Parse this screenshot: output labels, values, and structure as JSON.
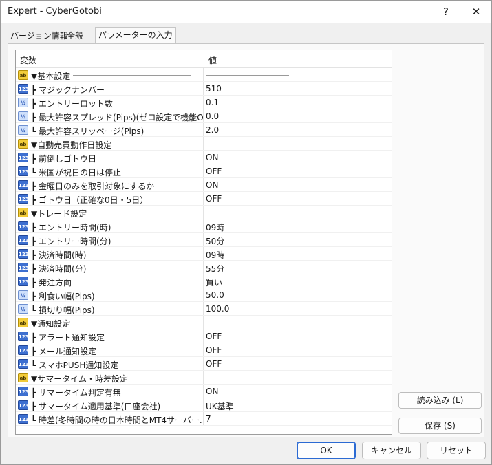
{
  "window": {
    "title": "Expert - CyberGotobi",
    "help": "?",
    "close": "✕"
  },
  "tabs": [
    {
      "label": "バージョン情報"
    },
    {
      "label": "全般"
    },
    {
      "label": "パラメーターの入力"
    }
  ],
  "grid": {
    "col_variable": "変数",
    "col_value": "値",
    "rows": [
      {
        "type": "str",
        "icon": "ab",
        "label": "▼基本設定",
        "value": "",
        "group": true
      },
      {
        "type": "int",
        "icon": "123",
        "label": "┣ マジックナンバー",
        "value": "510"
      },
      {
        "type": "dbl",
        "icon": "½",
        "label": "┣ エントリーロット数",
        "value": "0.1"
      },
      {
        "type": "dbl",
        "icon": "½",
        "label": "┣ 最大許容スプレッド(Pips)(ゼロ設定で機能Off)",
        "value": "0.0"
      },
      {
        "type": "dbl",
        "icon": "½",
        "label": "┗ 最大許容スリッページ(Pips)",
        "value": "2.0"
      },
      {
        "type": "str",
        "icon": "ab",
        "label": "▼自動売買動作日設定",
        "value": "",
        "group": true
      },
      {
        "type": "int",
        "icon": "123",
        "label": "┣ 前倒しゴトウ日",
        "value": "ON"
      },
      {
        "type": "int",
        "icon": "123",
        "label": "┗ 米国が祝日の日は停止",
        "value": "OFF"
      },
      {
        "type": "int",
        "icon": "123",
        "label": "┣ 金曜日のみを取引対象にするか",
        "value": "ON"
      },
      {
        "type": "int",
        "icon": "123",
        "label": "┣ ゴトウ日（正確な0日・5日）",
        "value": "OFF"
      },
      {
        "type": "str",
        "icon": "ab",
        "label": "▼トレード設定",
        "value": "",
        "group": true
      },
      {
        "type": "int",
        "icon": "123",
        "label": "┣ エントリー時間(時)",
        "value": "09時"
      },
      {
        "type": "int",
        "icon": "123",
        "label": "┣ エントリー時間(分)",
        "value": "50分"
      },
      {
        "type": "int",
        "icon": "123",
        "label": "┣ 決済時間(時)",
        "value": "09時"
      },
      {
        "type": "int",
        "icon": "123",
        "label": "┣ 決済時間(分)",
        "value": "55分"
      },
      {
        "type": "int",
        "icon": "123",
        "label": "┣ 発注方向",
        "value": "買い"
      },
      {
        "type": "dbl",
        "icon": "½",
        "label": "┣ 利食い幅(Pips)",
        "value": "50.0"
      },
      {
        "type": "dbl",
        "icon": "½",
        "label": "┗ 損切り幅(Pips)",
        "value": "100.0"
      },
      {
        "type": "str",
        "icon": "ab",
        "label": "▼通知設定",
        "value": "",
        "group": true
      },
      {
        "type": "int",
        "icon": "123",
        "label": "┣ アラート通知設定",
        "value": "OFF"
      },
      {
        "type": "int",
        "icon": "123",
        "label": "┣ メール通知設定",
        "value": "OFF"
      },
      {
        "type": "int",
        "icon": "123",
        "label": "┗ スマホPUSH通知設定",
        "value": "OFF"
      },
      {
        "type": "str",
        "icon": "ab",
        "label": "▼サマータイム・時差設定",
        "value": "",
        "group": true
      },
      {
        "type": "int",
        "icon": "123",
        "label": "┣ サマータイム判定有無",
        "value": "ON"
      },
      {
        "type": "int",
        "icon": "123",
        "label": "┣ サマータイム適用基準(口座会社)",
        "value": "UK基準"
      },
      {
        "type": "int",
        "icon": "123",
        "label": "┗ 時差(冬時間の時の日本時間とMT4サーバー..",
        "value": "7"
      }
    ]
  },
  "buttons": {
    "load": "読み込み (L)",
    "save": "保存 (S)",
    "ok": "OK",
    "cancel": "キャンセル",
    "reset": "リセット"
  },
  "colors": {
    "accent": "#2b6ad3",
    "int_icon": "#3d6fd0",
    "dbl_icon": "#cfe0fb",
    "str_icon": "#f2cc3a"
  }
}
